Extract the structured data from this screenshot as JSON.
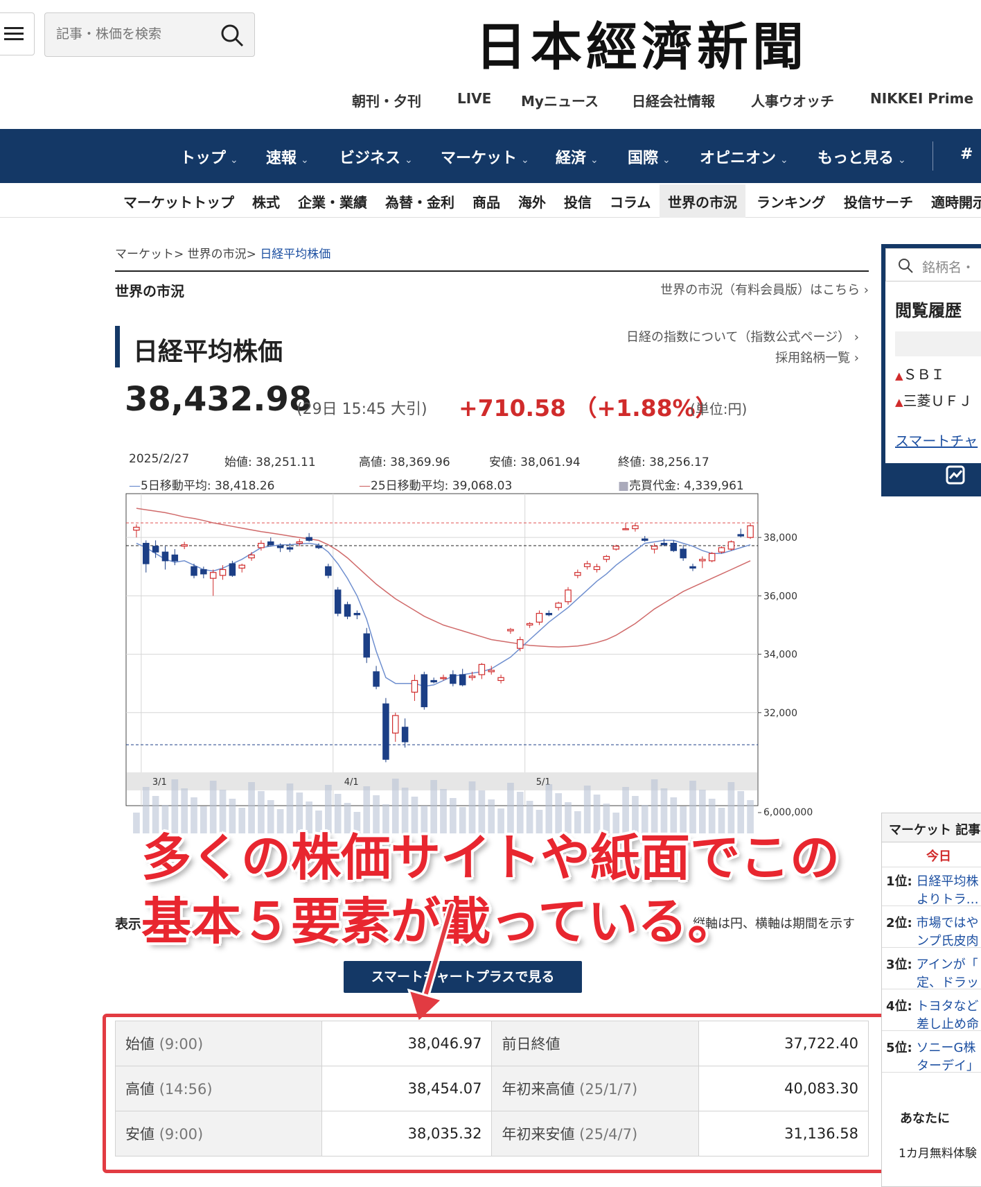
{
  "header": {
    "search_placeholder": "記事・株価を検索",
    "logo": "日本經濟新聞",
    "subnav": [
      "朝刊・夕刊",
      "LIVE",
      "Myニュース",
      "日経会社情報",
      "人事ウオッチ",
      "NIKKEI Prime"
    ],
    "mainnav": [
      "トップ",
      "速報",
      "ビジネス",
      "マーケット",
      "経済",
      "国際",
      "オピニオン",
      "もっと見る",
      "#"
    ],
    "marketnav": [
      "マーケットトップ",
      "株式",
      "企業・業績",
      "為替・金利",
      "商品",
      "海外",
      "投信",
      "コラム",
      "世界の市況",
      "ランキング",
      "投信サーチ",
      "適時開示"
    ]
  },
  "breadcrumb": {
    "items": [
      "マーケット>",
      "世界の市況>"
    ],
    "current": "日経平均株価"
  },
  "section": {
    "title": "世界の市況",
    "link": "世界の市況（有料会員版）はこちら ›"
  },
  "index": {
    "title": "日経平均株価",
    "link1": "日経の指数について（指数公式ページ） ›",
    "link2": "採用銘柄一覧 ›",
    "price": "38,432.98",
    "time": "(29日 15:45 大引)",
    "change": "+710.58 （+1.88%）",
    "unit": "(単位:円)"
  },
  "chart_info": {
    "date": "2025/2/27",
    "open": "始値: 38,251.11",
    "high": "高値: 38,369.96",
    "low": "安値: 38,061.94",
    "close": "終値: 38,256.17",
    "ma5": "5日移動平均: 38,418.26",
    "ma25": "25日移動平均: 39,068.03",
    "volume": "売買代金: 4,339,961"
  },
  "chart_data": {
    "type": "candlestick",
    "x_ticks": [
      "3/1",
      "4/1",
      "5/1"
    ],
    "y_ticks": [
      "38,000",
      "36,000",
      "34,000",
      "32,000"
    ],
    "volume_tick": "6,000,000",
    "ylim": [
      30000,
      39500
    ],
    "candles": [
      [
        38250,
        38450,
        38000,
        38350
      ],
      [
        37800,
        37900,
        36800,
        37100
      ],
      [
        37700,
        37900,
        37300,
        37500
      ],
      [
        37500,
        37700,
        36900,
        37200
      ],
      [
        37400,
        37600,
        37050,
        37200
      ],
      [
        37700,
        37850,
        37600,
        37750
      ],
      [
        37000,
        37100,
        36600,
        36700
      ],
      [
        36900,
        37000,
        36600,
        36750
      ],
      [
        36600,
        36900,
        36000,
        36800
      ],
      [
        36700,
        37050,
        36550,
        36900
      ],
      [
        37100,
        37200,
        36650,
        36700
      ],
      [
        36950,
        37100,
        36800,
        37050
      ],
      [
        37300,
        37500,
        37200,
        37400
      ],
      [
        37650,
        37900,
        37550,
        37800
      ],
      [
        37850,
        38000,
        37700,
        37750
      ],
      [
        37700,
        37800,
        37500,
        37650
      ],
      [
        37650,
        37800,
        37500,
        37600
      ],
      [
        37800,
        37950,
        37700,
        37850
      ],
      [
        38000,
        38150,
        37850,
        37900
      ],
      [
        37700,
        37800,
        37600,
        37650
      ],
      [
        37000,
        37100,
        36600,
        36700
      ],
      [
        36200,
        36300,
        35300,
        35400
      ],
      [
        35700,
        35800,
        35200,
        35300
      ],
      [
        35400,
        35500,
        35200,
        35350
      ],
      [
        34700,
        34900,
        33700,
        33900
      ],
      [
        33400,
        33600,
        32800,
        32900
      ],
      [
        32300,
        32500,
        30300,
        30400
      ],
      [
        31300,
        32000,
        31000,
        31900
      ],
      [
        31500,
        31800,
        30800,
        31000
      ],
      [
        32700,
        33300,
        32400,
        33100
      ],
      [
        33300,
        33400,
        32100,
        32200
      ],
      [
        33100,
        33200,
        33000,
        33050
      ],
      [
        33200,
        33300,
        33100,
        33200
      ],
      [
        33300,
        33450,
        32900,
        33000
      ],
      [
        33300,
        33500,
        32900,
        32950
      ],
      [
        33200,
        33400,
        33100,
        33250
      ],
      [
        33300,
        33700,
        33150,
        33650
      ],
      [
        33400,
        33600,
        33300,
        33450
      ],
      [
        33100,
        33300,
        33000,
        33200
      ],
      [
        34800,
        34900,
        34700,
        34850
      ],
      [
        34200,
        34600,
        34100,
        34500
      ],
      [
        35000,
        35100,
        34900,
        35050
      ],
      [
        35100,
        35500,
        35000,
        35400
      ],
      [
        35400,
        35500,
        35300,
        35350
      ],
      [
        35600,
        35800,
        35500,
        35750
      ],
      [
        35800,
        36300,
        35700,
        36200
      ],
      [
        36700,
        36900,
        36600,
        36800
      ],
      [
        37000,
        37200,
        36900,
        37100
      ],
      [
        36900,
        37100,
        36800,
        37000
      ],
      [
        37250,
        37400,
        37150,
        37350
      ],
      [
        37600,
        37750,
        37550,
        37700
      ],
      [
        38300,
        38500,
        38250,
        38300
      ],
      [
        38300,
        38500,
        38200,
        38400
      ],
      [
        37950,
        38050,
        37850,
        37900
      ],
      [
        37600,
        37800,
        37450,
        37700
      ],
      [
        37800,
        37950,
        37700,
        37750
      ],
      [
        37800,
        37900,
        37500,
        37550
      ],
      [
        37600,
        37750,
        37200,
        37300
      ],
      [
        37000,
        37100,
        36850,
        36950
      ],
      [
        37200,
        37350,
        36950,
        37250
      ],
      [
        37200,
        37500,
        37150,
        37450
      ],
      [
        37500,
        37700,
        37450,
        37650
      ],
      [
        37600,
        37900,
        37550,
        37850
      ],
      [
        38100,
        38300,
        38000,
        38050
      ],
      [
        38000,
        38500,
        37950,
        38400
      ]
    ],
    "ma5": [
      37800,
      37650,
      37450,
      37250,
      37150,
      37200,
      37050,
      36900,
      36850,
      36950,
      37100,
      37250,
      37450,
      37650,
      37700,
      37750,
      37750,
      37780,
      37800,
      37750,
      37500,
      37100,
      36600,
      36000,
      35200,
      34100,
      33200,
      33000,
      33000,
      33000,
      32900,
      32950,
      33100,
      33250,
      33300,
      33350,
      33400,
      33500,
      33700,
      33900,
      34200,
      34500,
      34800,
      35100,
      35350,
      35600,
      35900,
      36200,
      36500,
      36750,
      37050,
      37300,
      37550,
      37800,
      37850,
      37900,
      37900,
      37800,
      37700,
      37550,
      37450,
      37450,
      37550,
      37650,
      37750
    ],
    "ma25": [
      39000,
      38950,
      38900,
      38850,
      38780,
      38700,
      38650,
      38580,
      38500,
      38440,
      38380,
      38320,
      38260,
      38200,
      38150,
      38100,
      38050,
      38000,
      37950,
      37900,
      37750,
      37550,
      37300,
      37000,
      36700,
      36400,
      36150,
      35900,
      35700,
      35500,
      35300,
      35150,
      35000,
      34900,
      34800,
      34700,
      34600,
      34500,
      34450,
      34400,
      34350,
      34300,
      34280,
      34260,
      34250,
      34260,
      34280,
      34330,
      34400,
      34500,
      34650,
      34850,
      35050,
      35300,
      35550,
      35750,
      35950,
      36150,
      36300,
      36450,
      36600,
      36750,
      36900,
      37050,
      37200
    ],
    "dashed_upper": 38500,
    "dashed_mid": 37720,
    "dashed_lower": 30900
  },
  "annotation": {
    "line1": "多くの株価サイトや紙面でこの",
    "line2": "基本５要素が載っている。",
    "legend_left": "表示",
    "legend_right": "縦軸は円、横軸は期間を示す"
  },
  "smart_button": "スマートチャートプラスで見る",
  "table": [
    {
      "l1": "始値",
      "l1_sub": "(9:00)",
      "v1": "38,046.97",
      "l2": "前日終値",
      "l2_sub": "",
      "v2": "37,722.40"
    },
    {
      "l1": "高値",
      "l1_sub": "(14:56)",
      "v1": "38,454.07",
      "l2": "年初来高値",
      "l2_sub": "(25/1/7)",
      "v2": "40,083.30"
    },
    {
      "l1": "安値",
      "l1_sub": "(9:00)",
      "v1": "38,035.32",
      "l2": "年初来安値",
      "l2_sub": "(25/4/7)",
      "v2": "31,136.58"
    }
  ],
  "sidebar": {
    "search_placeholder": "銘柄名・",
    "history_title": "閲覧履歴",
    "items": [
      "ＳＢＩ",
      "三菱ＵＦＪ"
    ],
    "link": "スマートチャ"
  },
  "ranking": {
    "head": "マーケット 記事",
    "tab": "今日",
    "items": [
      {
        "pos": "1位:",
        "t1": "日経平均株",
        "t2": "よりトラ…"
      },
      {
        "pos": "2位:",
        "t1": "市場ではや",
        "t2": "ンプ氏皮肉"
      },
      {
        "pos": "3位:",
        "t1": "アインが「",
        "t2": "定、ドラッ"
      },
      {
        "pos": "4位:",
        "t1": "トヨタなど",
        "t2": "差し止め命"
      },
      {
        "pos": "5位:",
        "t1": "ソニーG株",
        "t2": "ターデイ」"
      }
    ],
    "cta1": "あなたに",
    "cta2": "1カ月無料体験"
  }
}
